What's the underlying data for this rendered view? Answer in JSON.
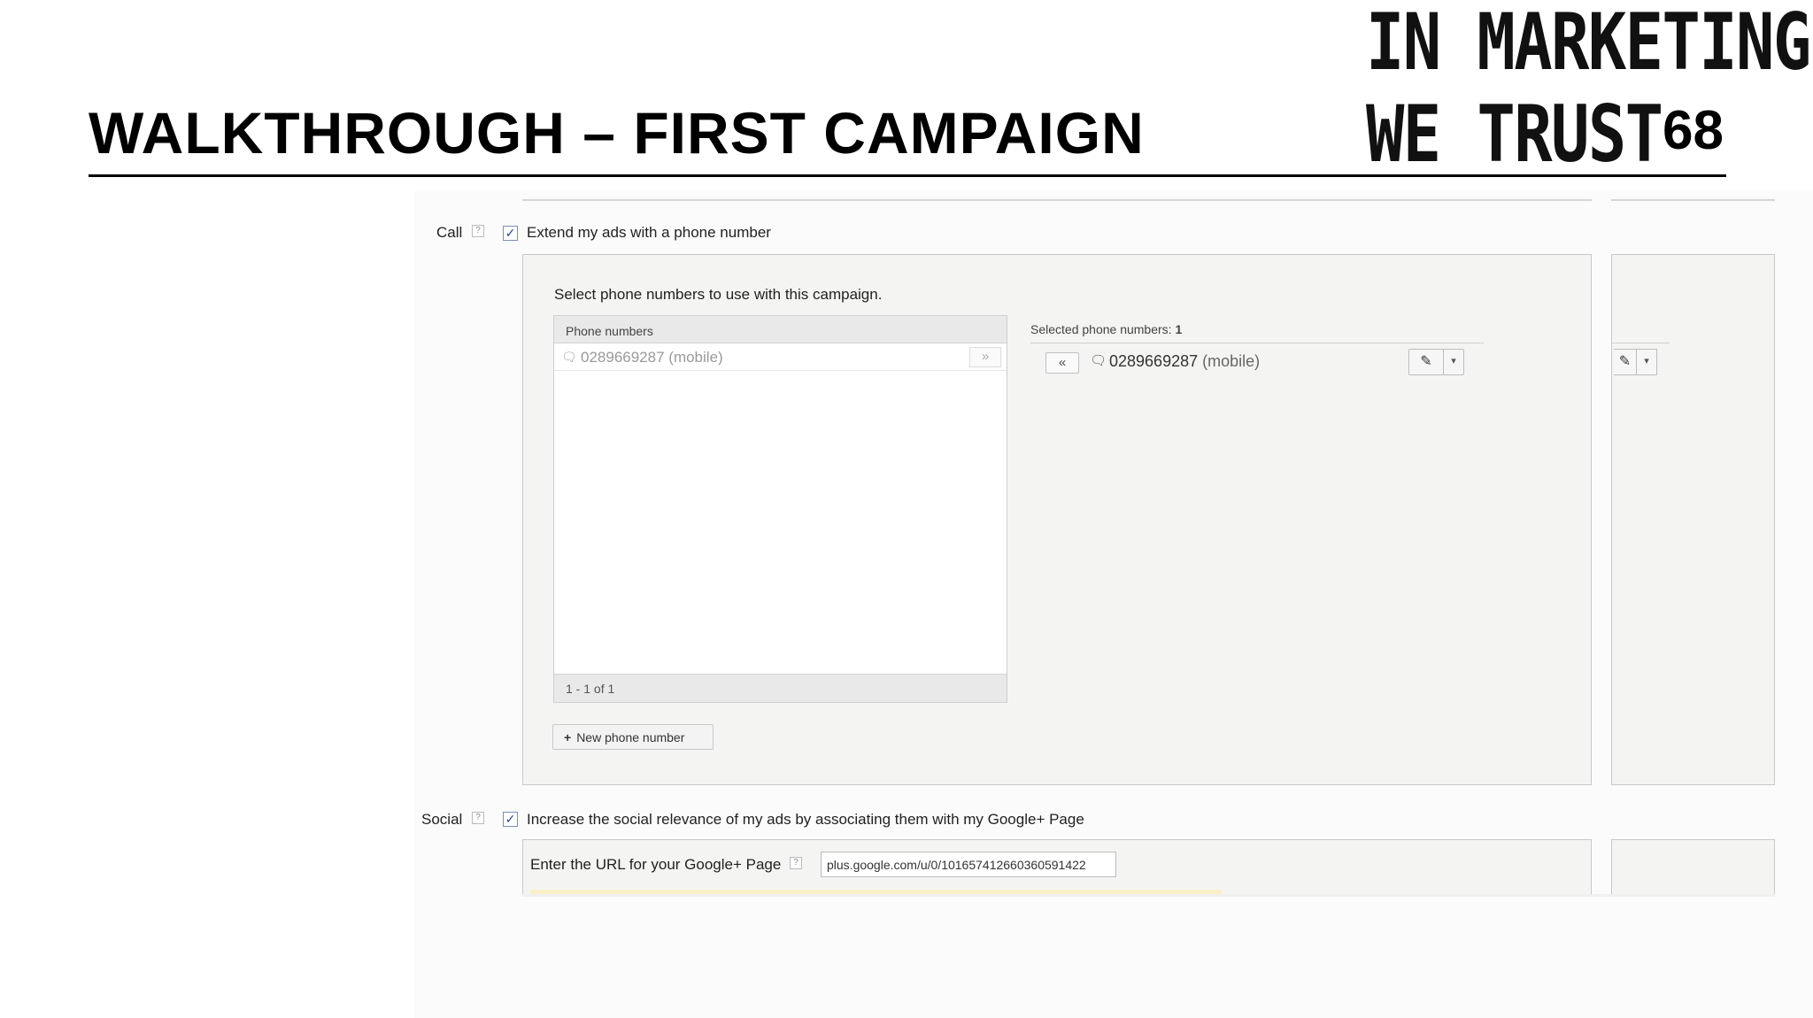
{
  "slide": {
    "title": "WALKTHROUGH – FIRST CAMPAIGN",
    "brand_line1": "IN MARKETING",
    "brand_line2": "WE TRUST",
    "page_number": "68"
  },
  "call": {
    "label": "Call",
    "help": "?",
    "checkbox_checked": true,
    "checkbox_text": "Extend my ads with a phone number",
    "instruction": "Select phone numbers to use with this campaign.",
    "list": {
      "header": "Phone numbers",
      "rows": [
        {
          "number": "0289669287",
          "type": "(mobile)",
          "add_label": "»"
        }
      ],
      "footer": "1 - 1 of 1"
    },
    "new_phone_button": "New phone number",
    "new_phone_icon": "+",
    "selected": {
      "header_label": "Selected phone numbers:",
      "count": "1",
      "remove_label": "«",
      "items": [
        {
          "number": "0289669287",
          "type": "(mobile)"
        }
      ],
      "edit_icon": "pencil-icon",
      "dropdown_icon": "caret-down-icon"
    }
  },
  "social": {
    "label": "Social",
    "help": "?",
    "checkbox_checked": true,
    "checkbox_text": "Increase the social relevance of my ads by associating them with my Google+ Page",
    "url_label": "Enter the URL for your Google+ Page",
    "url_value": "plus.google.com/u/0/101657412660360591422"
  }
}
